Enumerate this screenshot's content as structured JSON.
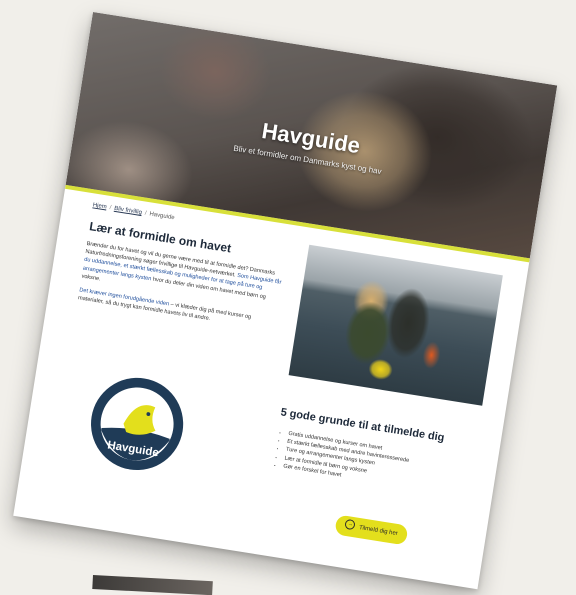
{
  "hero": {
    "title": "Havguide",
    "subtitle": "Bliv et formidler om Danmarks kyst og hav"
  },
  "breadcrumb": {
    "items": [
      "Hjem",
      "Bliv frivillig",
      "Havguide"
    ]
  },
  "intro": {
    "title": "Lær at formidle om havet",
    "paragraph1": "Brænder du for havet og vil du gerne være med til at formidle det? Danmarks Naturfredningsforening søger frivillige til Havguide-netværket.",
    "paragraph1_highlight": "Som Havguide får du uddannelse, et stærkt fællesskab og muligheder for at tage på ture og arrangementer langs kysten",
    "paragraph1_end": "hvor du deler din viden om havet med børn og voksne.",
    "paragraph2_highlight": "Det kræver ingen forudgående viden",
    "paragraph2": "– vi klæder dig på med kurser og materialer, så du trygt kan formidle havets liv til andre."
  },
  "benefits": {
    "title": "5 gode grunde til at tilmelde dig",
    "items": [
      "Gratis uddannelse og kurser om havet",
      "Et stærkt fællesskab med andre havinteresserede",
      "Ture og arrangementer langs kysten",
      "Lær at formidle til børn og voksne",
      "Gør en forskel for havet"
    ]
  },
  "logo": {
    "ring_text": "Danmarks Natur Fredningsforening",
    "name": "Havguide"
  },
  "signup": {
    "label": "Tilmeld dig her"
  },
  "colors": {
    "accent": "#d8e03a",
    "button": "#e3df1c",
    "logo_ring": "#1f3b57",
    "heading": "#1e2a3a"
  }
}
